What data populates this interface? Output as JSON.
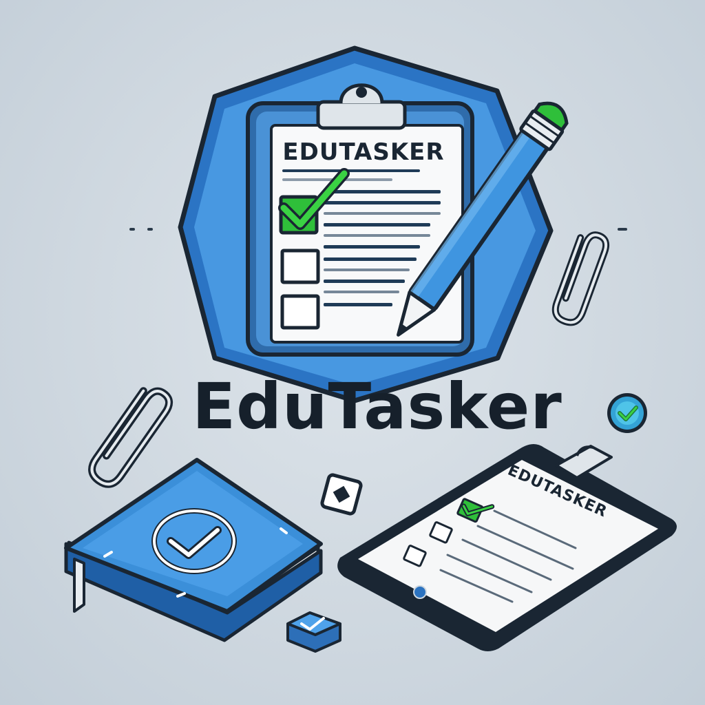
{
  "brand": {
    "name": "EduTasker",
    "clipboard_label": "EDUTASKER",
    "tablet_label": "EDUTASKER"
  },
  "colors": {
    "primary_blue": "#3b8fd9",
    "dark_blue": "#1f4f86",
    "outline": "#18222d",
    "check_green": "#32c43a",
    "paper": "#f7f8f9"
  },
  "icons": {
    "main": "clipboard-checklist-icon",
    "pencil": "pencil-icon",
    "book": "book-check-icon",
    "tablet": "tablet-checklist-icon",
    "paperclips": "paperclip-icon",
    "badge": "check-badge-icon"
  }
}
